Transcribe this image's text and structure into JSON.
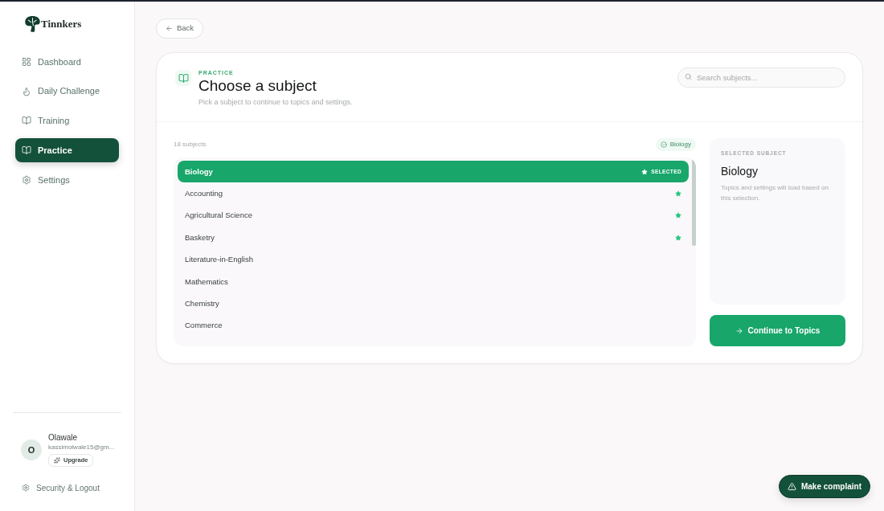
{
  "brand": {
    "name": "Tinnkers"
  },
  "nav": [
    {
      "label": "Dashboard",
      "selected": false
    },
    {
      "label": "Daily Challenge",
      "selected": false
    },
    {
      "label": "Training",
      "selected": false
    },
    {
      "label": "Practice",
      "selected": true
    },
    {
      "label": "Settings",
      "selected": false
    }
  ],
  "user": {
    "initial": "O",
    "name": "Olawale",
    "email": "kassimolwale15@gm...",
    "upgrade_label": "Upgrade"
  },
  "footer_link": "Security & Logout",
  "back_button": "Back",
  "header": {
    "eyebrow": "PRACTICE",
    "title": "Choose a subject",
    "subtitle": "Pick a subject to continue to topics and settings.",
    "search_placeholder": "Search subjects..."
  },
  "list": {
    "count": "18 subjects",
    "selected_chip": "Biology",
    "selected_badge": "SELECTED",
    "subjects": [
      {
        "name": "Biology",
        "selected": true,
        "favorite": true
      },
      {
        "name": "Accounting",
        "selected": false,
        "favorite": true
      },
      {
        "name": "Agricultural Science",
        "selected": false,
        "favorite": true
      },
      {
        "name": "Basketry",
        "selected": false,
        "favorite": true
      },
      {
        "name": "Literature-in-English",
        "selected": false,
        "favorite": false
      },
      {
        "name": "Mathematics",
        "selected": false,
        "favorite": false
      },
      {
        "name": "Chemistry",
        "selected": false,
        "favorite": false
      },
      {
        "name": "Commerce",
        "selected": false,
        "favorite": false
      }
    ]
  },
  "summary": {
    "label": "SELECTED SUBJECT",
    "title": "Biology",
    "note": "Topics and settings will load based on this selection."
  },
  "continue_button": "Continue to Topics",
  "complaint_button": "Make complaint"
}
